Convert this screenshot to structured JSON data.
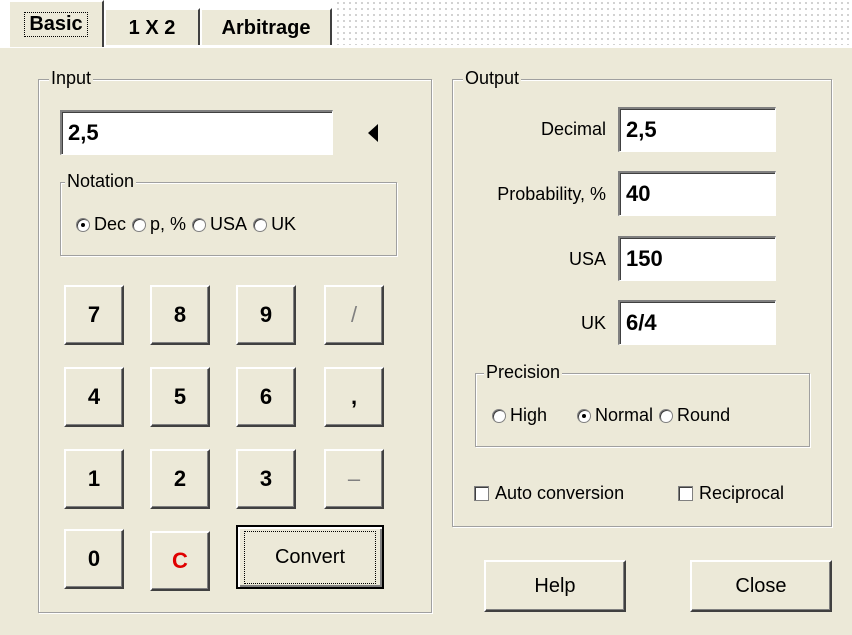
{
  "tabs": [
    {
      "label": "Basic"
    },
    {
      "label": "1 X 2"
    },
    {
      "label": "Arbitrage"
    }
  ],
  "input": {
    "legend": "Input",
    "value": "2,5",
    "arrow_icon": "left-triangle-icon",
    "notation": {
      "legend": "Notation",
      "options": [
        "Dec",
        "p, %",
        "USA",
        "UK"
      ],
      "selected": "Dec"
    },
    "keypad": {
      "keys": [
        "7",
        "8",
        "9",
        "/",
        "4",
        "5",
        "6",
        ",",
        "1",
        "2",
        "3",
        "–",
        "0",
        "C"
      ],
      "convert": "Convert"
    }
  },
  "output": {
    "legend": "Output",
    "decimal_label": "Decimal",
    "decimal_value": "2,5",
    "probability_label": "Probability, %",
    "probability_value": "40",
    "usa_label": "USA",
    "usa_value": "150",
    "uk_label": "UK",
    "uk_value": "6/4",
    "precision": {
      "legend": "Precision",
      "options": [
        "High",
        "Normal",
        "Round"
      ],
      "selected": "Normal"
    },
    "auto_conversion": "Auto conversion",
    "reciprocal": "Reciprocal"
  },
  "buttons": {
    "help": "Help",
    "close": "Close"
  },
  "colors": {
    "panel": "#ece9d8",
    "clear_key": "#e00000"
  }
}
